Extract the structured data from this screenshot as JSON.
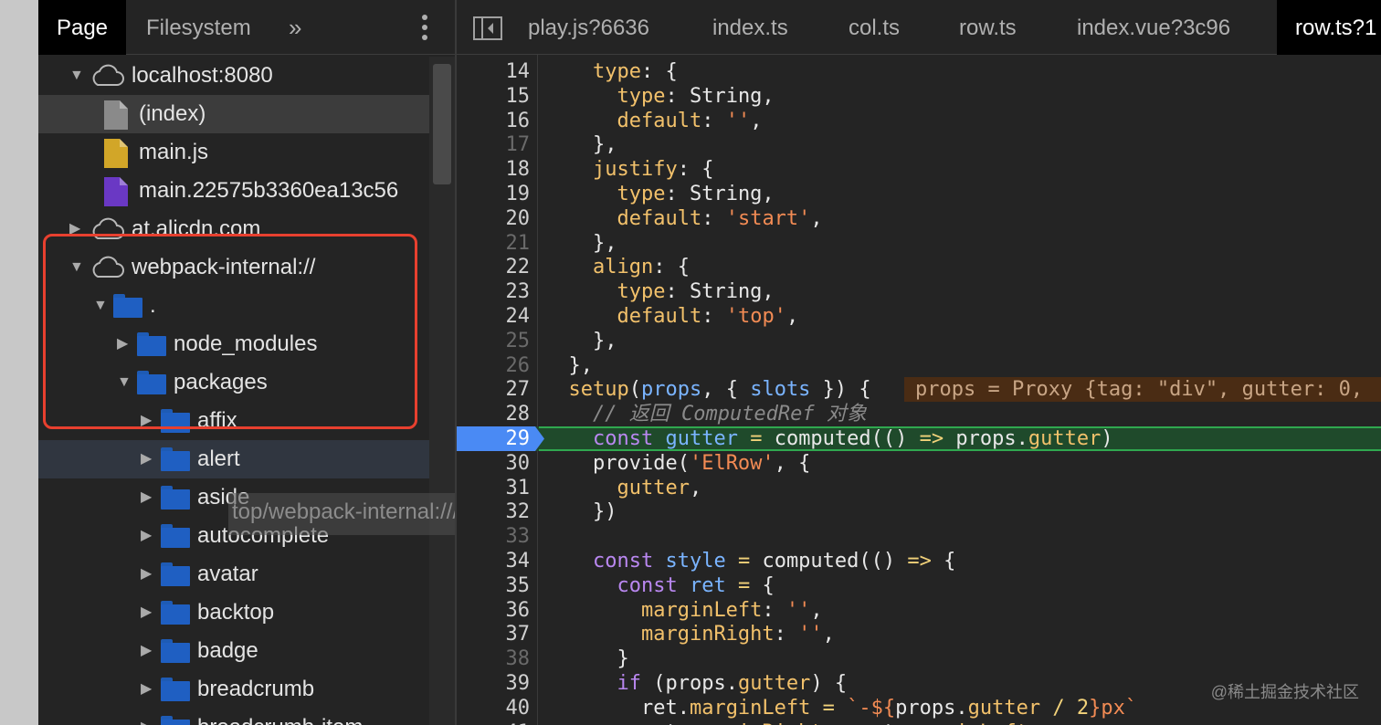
{
  "navigator": {
    "tabs": [
      "Page",
      "Filesystem"
    ],
    "more_label": "»",
    "tree": [
      {
        "label": "localhost:8080",
        "type": "cloud",
        "indent": 0,
        "expanded": true
      },
      {
        "label": "(index)",
        "type": "file-gray",
        "indent": 1,
        "selected": true
      },
      {
        "label": "main.js",
        "type": "file-yellow",
        "indent": 1
      },
      {
        "label": "main.22575b3360ea13c56",
        "type": "file-purple",
        "indent": 1
      },
      {
        "label": "at.alicdn.com",
        "type": "cloud",
        "indent": 0,
        "expanded": false
      },
      {
        "label": "webpack-internal://",
        "type": "cloud",
        "indent": 0,
        "expanded": true
      },
      {
        "label": ".",
        "type": "folder",
        "indent": 1,
        "expanded": true
      },
      {
        "label": "node_modules",
        "type": "folder",
        "indent": 2,
        "expanded": false
      },
      {
        "label": "packages",
        "type": "folder",
        "indent": 2,
        "expanded": true
      },
      {
        "label": "affix",
        "type": "folder",
        "indent": 3,
        "expanded": false
      },
      {
        "label": "alert",
        "type": "folder",
        "indent": 3,
        "expanded": false,
        "hover": true
      },
      {
        "label": "aside",
        "type": "folder",
        "indent": 3,
        "expanded": false
      },
      {
        "label": "autocomplete",
        "type": "folder",
        "indent": 3,
        "expanded": false
      },
      {
        "label": "avatar",
        "type": "folder",
        "indent": 3,
        "expanded": false
      },
      {
        "label": "backtop",
        "type": "folder",
        "indent": 3,
        "expanded": false
      },
      {
        "label": "badge",
        "type": "folder",
        "indent": 3,
        "expanded": false
      },
      {
        "label": "breadcrumb",
        "type": "folder",
        "indent": 3,
        "expanded": false
      },
      {
        "label": "breadcrumb-item",
        "type": "folder",
        "indent": 3,
        "expanded": false
      }
    ],
    "tooltip": "top/webpack-internal:///./packages/alert"
  },
  "editor": {
    "tabs": [
      "play.js?6636",
      "index.ts",
      "col.ts",
      "row.ts",
      "index.vue?3c96",
      "row.ts?1"
    ],
    "active_tab": 5,
    "execution_line": 29,
    "inline_value": "props = Proxy {tag: \"div\", gutter: 0,",
    "lines": [
      {
        "n": "14",
        "html": "    <span class='k'>type</span>: {"
      },
      {
        "n": "15",
        "html": "      <span class='k'>type</span>: String,"
      },
      {
        "n": "16",
        "html": "      <span class='k'>default</span>: <span class='s'>''</span>,"
      },
      {
        "n": "17",
        "html": "    },",
        "dim": true
      },
      {
        "n": "18",
        "html": "    <span class='k'>justify</span>: {"
      },
      {
        "n": "19",
        "html": "      <span class='k'>type</span>: String,"
      },
      {
        "n": "20",
        "html": "      <span class='k'>default</span>: <span class='s'>'start'</span>,"
      },
      {
        "n": "21",
        "html": "    },",
        "dim": true
      },
      {
        "n": "22",
        "html": "    <span class='k'>align</span>: {"
      },
      {
        "n": "23",
        "html": "      <span class='k'>type</span>: String,"
      },
      {
        "n": "24",
        "html": "      <span class='k'>default</span>: <span class='s'>'top'</span>,"
      },
      {
        "n": "25",
        "html": "    },",
        "dim": true
      },
      {
        "n": "26",
        "html": "  },",
        "dim": true
      },
      {
        "n": "27",
        "html": "  <span class='k'>setup</span>(<span class='v'>props</span>, { <span class='v'>slots</span> }) {"
      },
      {
        "n": "28",
        "html": "    <span class='cm'>// 返回 ComputedRef 对象</span>"
      },
      {
        "n": "29",
        "html": "    <span class='kw'>const</span> <span class='v'>gutter</span> <span class='str2'>=</span> computed(() <span class='str2'>=&gt;</span> props.<span class='k'>gutter</span>)"
      },
      {
        "n": "30",
        "html": "    provide(<span class='s'>'ElRow'</span>, {"
      },
      {
        "n": "31",
        "html": "      <span class='k'>gutter</span>,"
      },
      {
        "n": "32",
        "html": "    })"
      },
      {
        "n": "33",
        "html": "",
        "dim": true
      },
      {
        "n": "34",
        "html": "    <span class='kw'>const</span> <span class='v'>style</span> <span class='str2'>=</span> computed(() <span class='str2'>=&gt;</span> {"
      },
      {
        "n": "35",
        "html": "      <span class='kw'>const</span> <span class='v'>ret</span> <span class='str2'>=</span> {"
      },
      {
        "n": "36",
        "html": "        <span class='k'>marginLeft</span>: <span class='s'>''</span>,"
      },
      {
        "n": "37",
        "html": "        <span class='k'>marginRight</span>: <span class='s'>''</span>,"
      },
      {
        "n": "38",
        "html": "      }",
        "dim": true
      },
      {
        "n": "39",
        "html": "      <span class='kw'>if</span> (props.<span class='k'>gutter</span>) {"
      },
      {
        "n": "40",
        "html": "        ret.<span class='k'>marginLeft</span> <span class='str2'>=</span> <span class='s'>`-${</span>props.<span class='k'>gutter</span> <span class='str2'>/</span> <span class='str2'>2</span><span class='s'>}px`</span>"
      },
      {
        "n": "41",
        "html": "        ret.<span class='k'>marginRight</span> <span class='str2'>=</span> ret.<span class='k'>marginLeft</span>"
      }
    ]
  },
  "watermark": "@稀土掘金技术社区",
  "colors": {
    "highlight_box": "#e8402f",
    "execution_line": "#21452d",
    "breakpoint_marker": "#4a8af4"
  }
}
